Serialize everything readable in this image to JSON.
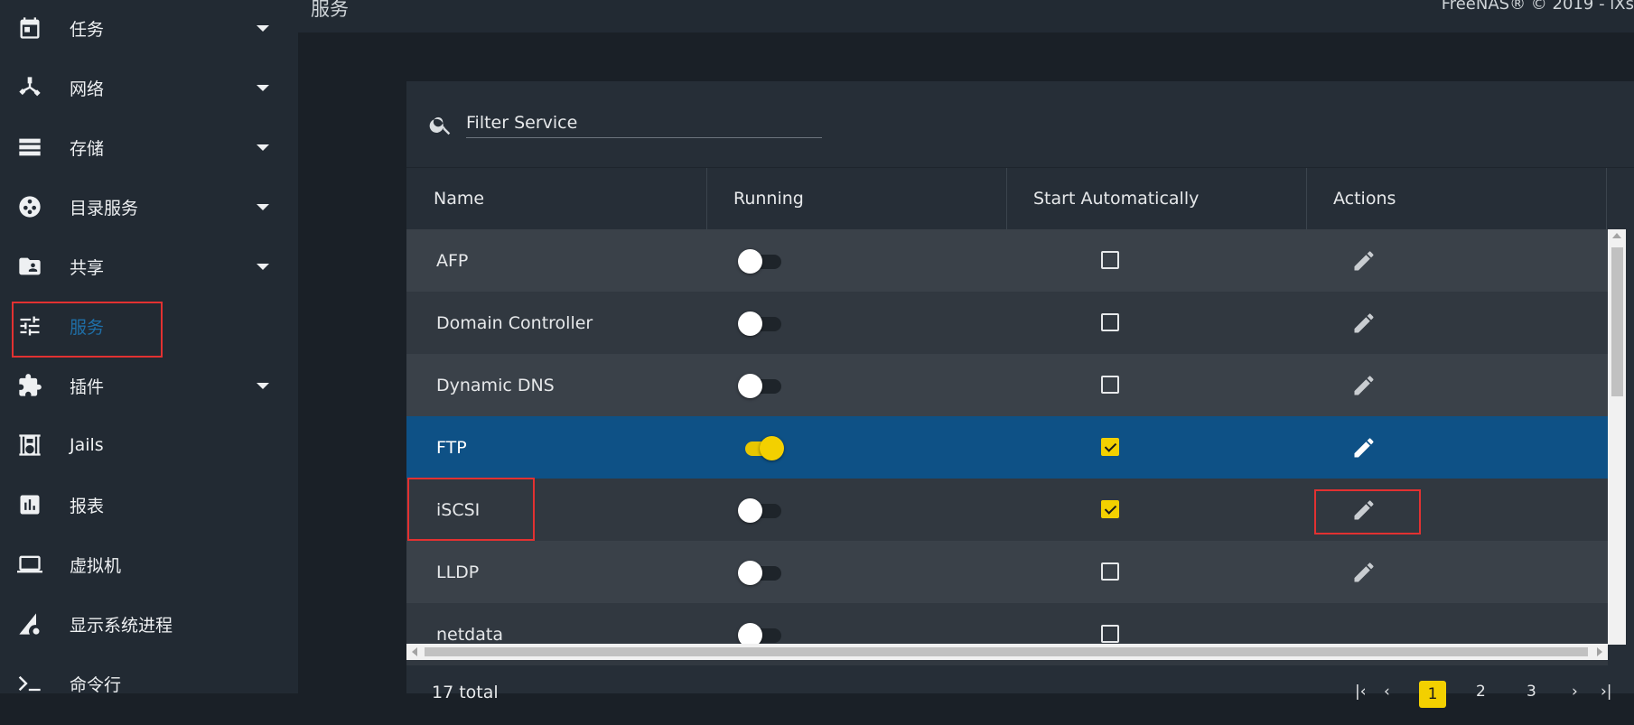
{
  "sidebar": {
    "items": [
      {
        "label": "任务",
        "icon": "calendar-icon",
        "expandable": true
      },
      {
        "label": "网络",
        "icon": "network-icon",
        "expandable": true
      },
      {
        "label": "存储",
        "icon": "storage-icon",
        "expandable": true
      },
      {
        "label": "目录服务",
        "icon": "directory-services-icon",
        "expandable": true
      },
      {
        "label": "共享",
        "icon": "shared-folder-icon",
        "expandable": true
      },
      {
        "label": "服务",
        "icon": "tune-sliders-icon",
        "expandable": false,
        "active": true
      },
      {
        "label": "插件",
        "icon": "puzzle-piece-icon",
        "expandable": true
      },
      {
        "label": "Jails",
        "icon": "jail-icon",
        "expandable": false
      },
      {
        "label": "报表",
        "icon": "chart-report-icon",
        "expandable": false
      },
      {
        "label": "虚拟机",
        "icon": "laptop-icon",
        "expandable": false
      },
      {
        "label": "显示系统进程",
        "icon": "system-processes-icon",
        "expandable": false
      },
      {
        "label": "命令行",
        "icon": "terminal-icon",
        "expandable": false
      }
    ]
  },
  "header": {
    "page_title": "服务",
    "copyright": "FreeNAS® © 2019 - iXs"
  },
  "filter": {
    "placeholder": "Filter Service",
    "value": ""
  },
  "table": {
    "columns": [
      "Name",
      "Running",
      "Start Automatically",
      "Actions"
    ],
    "rows": [
      {
        "name": "AFP",
        "running": false,
        "start_automatically": false,
        "action_icon": "edit-pencil-icon"
      },
      {
        "name": "Domain Controller",
        "running": false,
        "start_automatically": false,
        "action_icon": "edit-pencil-icon"
      },
      {
        "name": "Dynamic DNS",
        "running": false,
        "start_automatically": false,
        "action_icon": "edit-pencil-icon"
      },
      {
        "name": "FTP",
        "running": true,
        "start_automatically": true,
        "action_icon": "edit-pencil-icon",
        "selected": true
      },
      {
        "name": "iSCSI",
        "running": false,
        "start_automatically": true,
        "action_icon": "edit-pencil-icon"
      },
      {
        "name": "LLDP",
        "running": false,
        "start_automatically": false,
        "action_icon": "edit-pencil-icon"
      },
      {
        "name": "netdata",
        "running": false,
        "start_automatically": false,
        "action_icon": "edit-pencil-icon"
      }
    ]
  },
  "footer": {
    "total_label": "17 total",
    "pager": {
      "current": "1",
      "pages": [
        "1",
        "2",
        "3"
      ]
    }
  },
  "colors": {
    "sidebar_bg": "#222a33",
    "active_nav": "#1f6fa8",
    "selected_row": "#0e5186",
    "accent_yellow": "#f3d000",
    "highlight_box": "#e23131"
  }
}
